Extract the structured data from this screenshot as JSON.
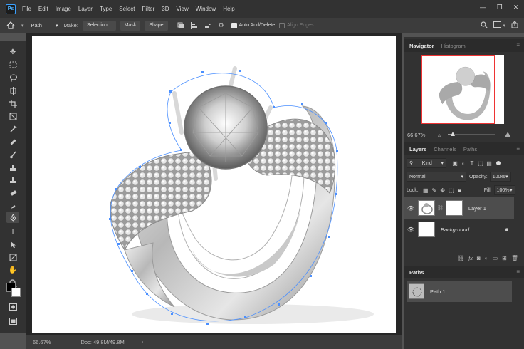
{
  "menu": {
    "logo": "Ps",
    "items": [
      "File",
      "Edit",
      "Image",
      "Layer",
      "Type",
      "Select",
      "Filter",
      "3D",
      "View",
      "Window",
      "Help"
    ],
    "window_controls": [
      "—",
      "❐",
      "✕"
    ]
  },
  "options": {
    "mode_value": "Path",
    "make_label": "Make:",
    "selection_button": "Selection...",
    "mask_button": "Mask",
    "shape_button": "Shape",
    "auto_add_delete": {
      "label": "Auto Add/Delete",
      "checked": true
    },
    "align_edges": {
      "label": "Align Edges",
      "checked": false,
      "disabled": true
    }
  },
  "canvas": {
    "zoom": "66.67%",
    "doc_info": "Doc: 49.8M/49.8M"
  },
  "navigator": {
    "tabs": [
      "Navigator",
      "Histogram"
    ],
    "active_tab": "Navigator",
    "zoom": "66.67%",
    "zoom_fraction": 0.1
  },
  "layers": {
    "tabs": [
      "Layers",
      "Channels",
      "Paths"
    ],
    "active_tab": "Layers",
    "filter_kind": "Kind",
    "blend_mode": "Normal",
    "opacity_label": "Opacity:",
    "opacity": "100%",
    "lock_label": "Lock:",
    "fill_label": "Fill:",
    "fill": "100%",
    "items": [
      {
        "name": "Layer 1",
        "selected": true,
        "has_mask": true,
        "italic": false
      },
      {
        "name": "Background",
        "selected": false,
        "has_mask": false,
        "italic": true,
        "locked": true
      }
    ]
  },
  "paths": {
    "title": "Paths",
    "items": [
      {
        "name": "Path 1"
      }
    ]
  },
  "colors": {
    "app_bg": "#535353",
    "panel_bg": "#323232",
    "path_stroke": "#4a8fff",
    "nav_view_box": "#e33333"
  }
}
